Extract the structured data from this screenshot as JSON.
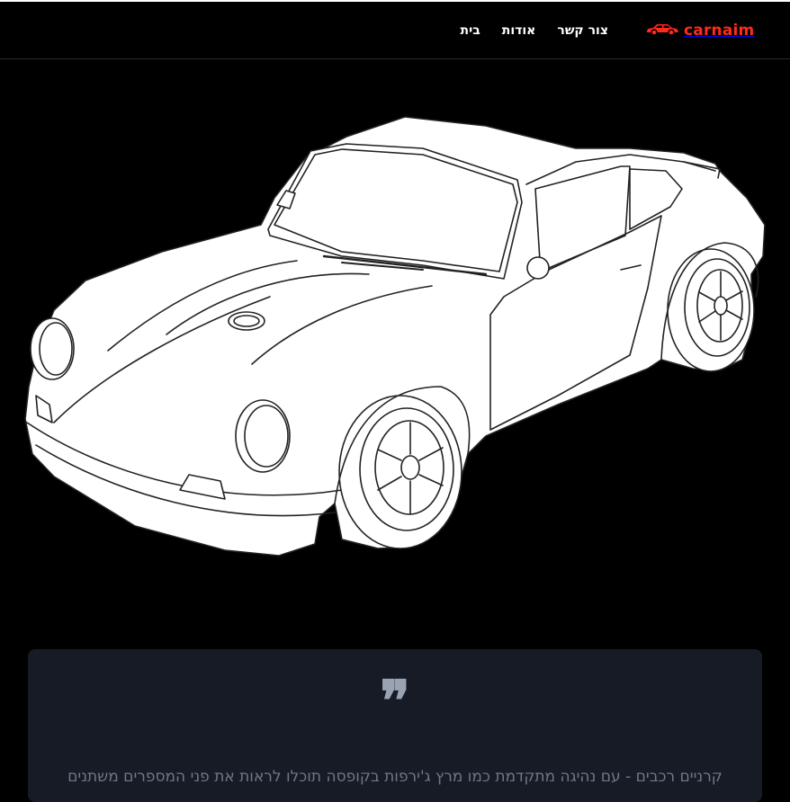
{
  "brand": {
    "name": "carnaim",
    "color": "#ff2a1c",
    "icon": "car-icon"
  },
  "nav": {
    "items": [
      {
        "label": "בית"
      },
      {
        "label": "אודות"
      },
      {
        "label": "צור קשר"
      }
    ]
  },
  "hero": {
    "image": "porsche-line-drawing",
    "stroke_color": "#ffffff",
    "background": "#000000"
  },
  "quote": {
    "mark": "❞",
    "text": "קרניים רכבים - עם נהיגה מתקדמת כמו מרץ ג'ירפות בקופסה תוכלו לראות את פני המספרים משתנים",
    "background": "#161b26"
  }
}
